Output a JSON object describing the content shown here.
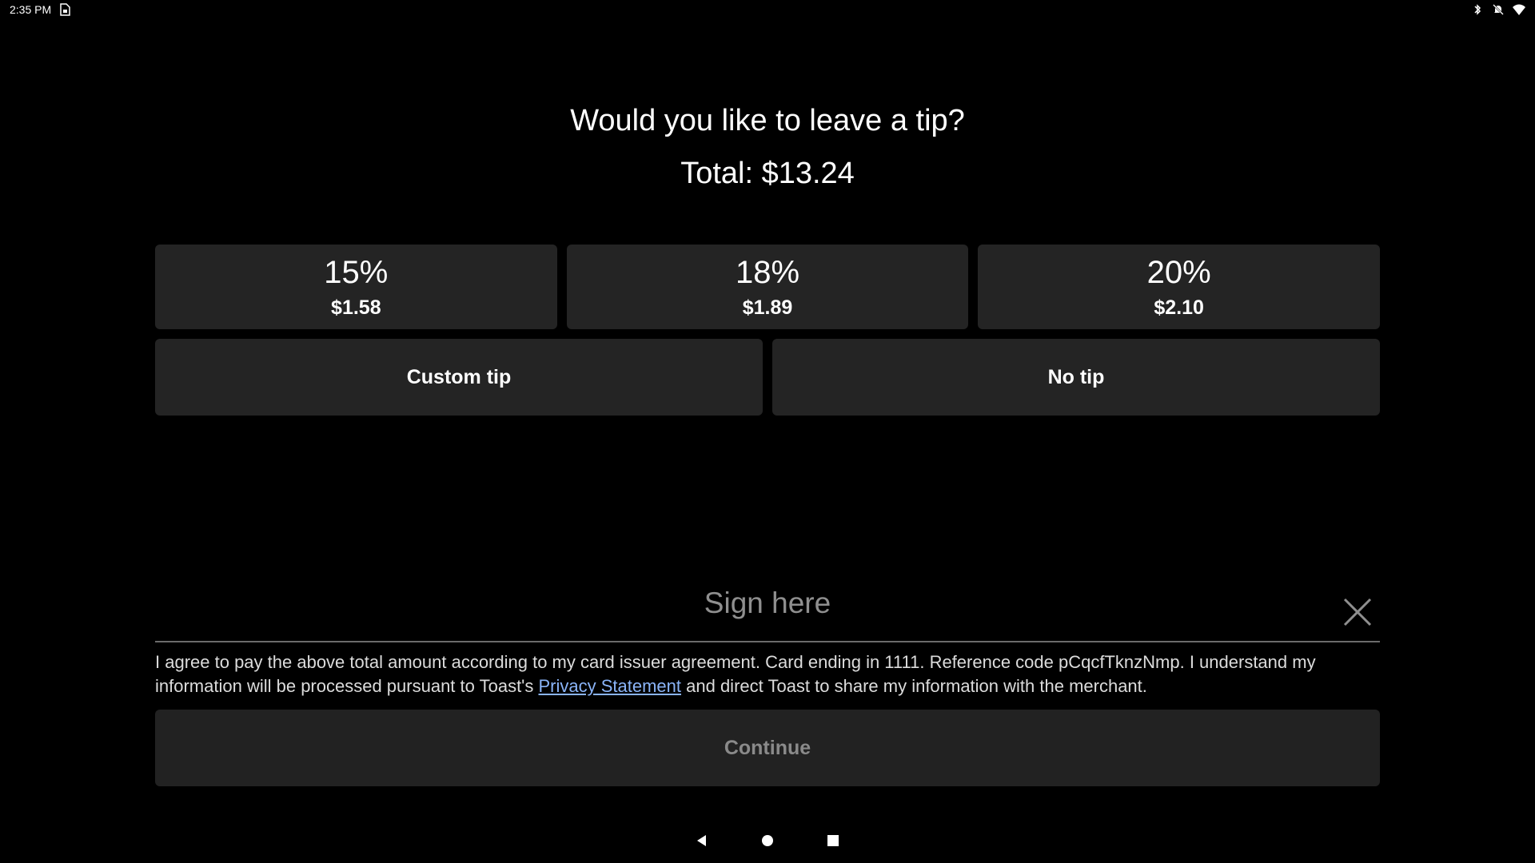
{
  "status_bar": {
    "time": "2:35 PM",
    "left_icons": [
      "sim-card-icon"
    ],
    "right_icons": [
      "bluetooth-icon",
      "notifications-off-icon",
      "wifi-icon"
    ]
  },
  "prompt": {
    "title": "Would you like to leave a tip?",
    "total": "Total: $13.24"
  },
  "tip_options": [
    {
      "percent": "15%",
      "amount": "$1.58"
    },
    {
      "percent": "18%",
      "amount": "$1.89"
    },
    {
      "percent": "20%",
      "amount": "$2.10"
    }
  ],
  "other_options": {
    "custom_tip": "Custom tip",
    "no_tip": "No tip"
  },
  "signature": {
    "placeholder": "Sign here",
    "clear_icon": "close-icon"
  },
  "agreement": {
    "text_before_link": "I agree to pay the above total amount according to my card issuer agreement. Card ending in 1111. Reference code pCqcfTknzNmp. I understand my information will be processed pursuant to Toast's ",
    "link_text": "Privacy Statement",
    "text_after_link": " and direct Toast to share my information with the merchant."
  },
  "continue_label": "Continue",
  "nav_bar": {
    "icons": [
      "back-icon",
      "home-icon",
      "recents-icon"
    ]
  },
  "colors": {
    "background": "#000000",
    "button_background": "#242424",
    "link": "#8ab4f8",
    "disabled_text": "#8a8a8a"
  }
}
